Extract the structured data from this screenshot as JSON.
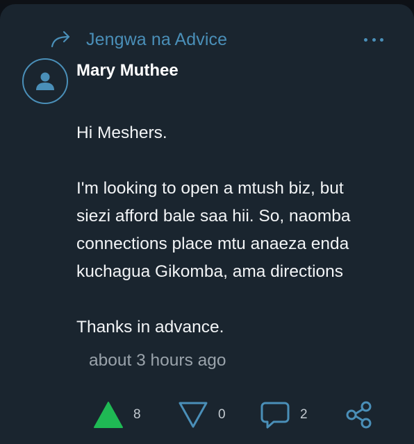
{
  "post": {
    "channel": "Jengwa na Advice",
    "author": "Mary Muthee",
    "body": {
      "greeting": "Hi Meshers.",
      "line1": "I'm looking to open a mtush biz, but",
      "line2": "siezi afford bale saa hii. So, naomba",
      "line3": "connections  place mtu anaeza enda",
      "line4": "kuchagua Gikomba, ama directions",
      "closing": "Thanks in advance."
    },
    "timestamp": "about 3 hours ago"
  },
  "actions": {
    "upvotes": "8",
    "downvotes": "0",
    "comments": "2"
  },
  "icons": {
    "channel": "share-forward-icon",
    "menu": "more-dots-icon",
    "avatar": "user-avatar-icon",
    "upvote": "upvote-triangle-icon",
    "downvote": "downvote-triangle-icon",
    "comment": "comment-bubble-icon",
    "share": "share-icon"
  },
  "colors": {
    "card_background": "#1a252f",
    "accent": "#4a8fb8",
    "upvote_active": "#1fb954",
    "text": "#f2f4f6",
    "muted": "#9aa3ab"
  }
}
